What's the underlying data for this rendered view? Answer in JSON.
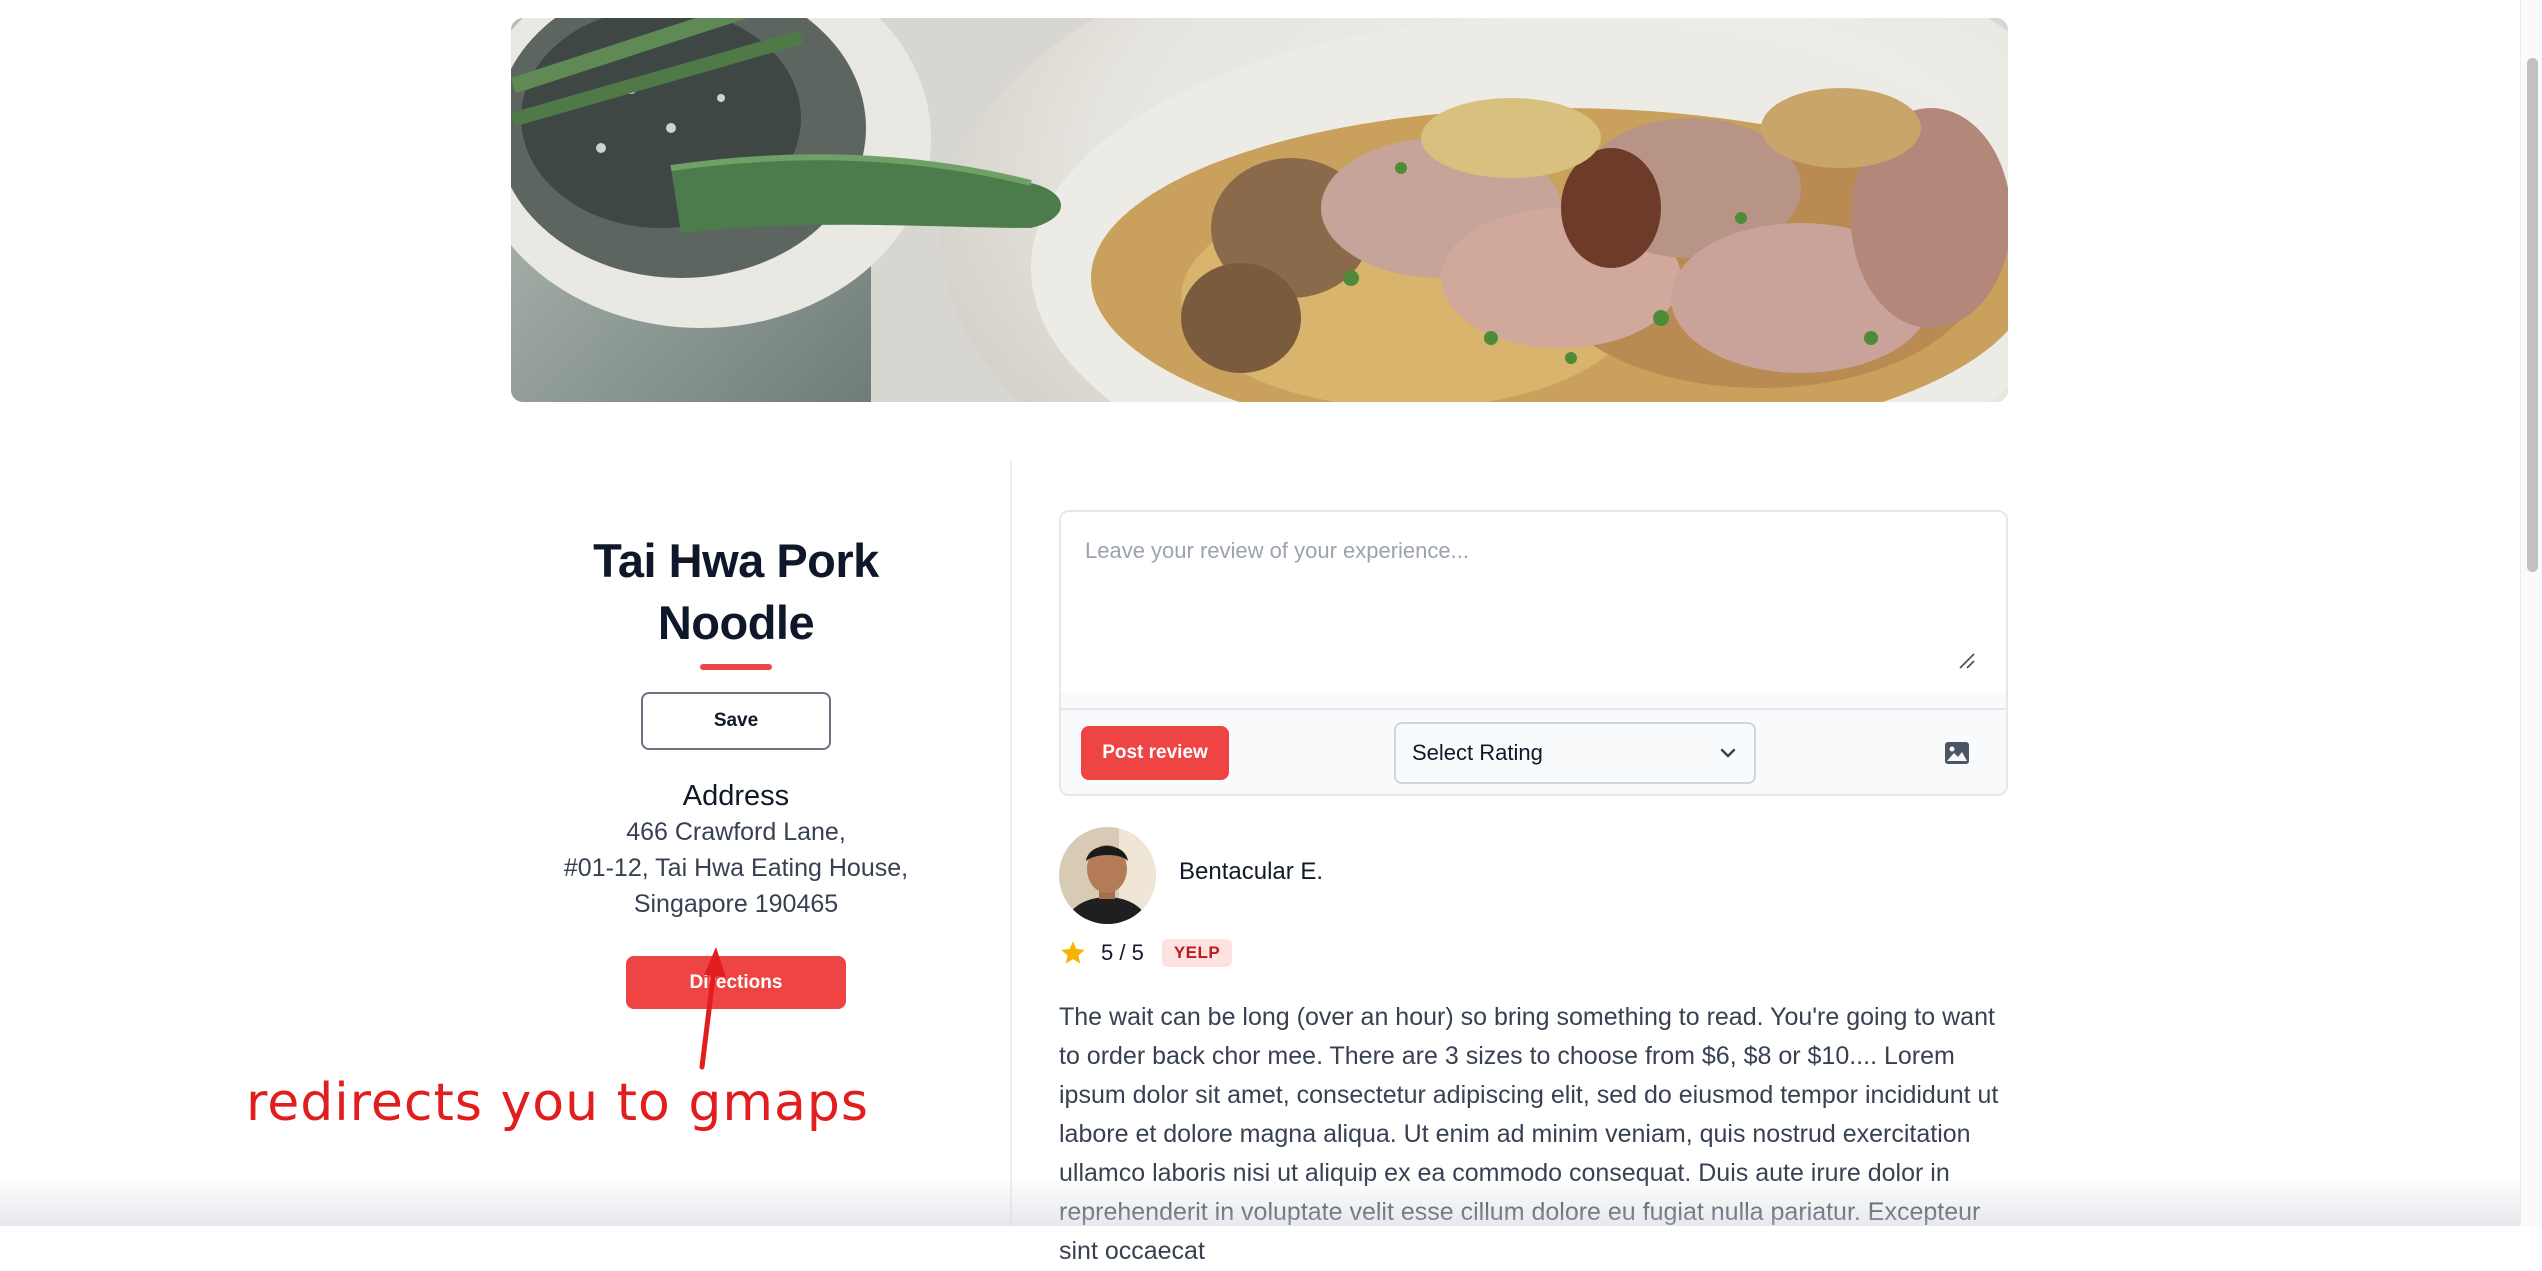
{
  "restaurant": {
    "name": "Tai Hwa Pork Noodle",
    "save_label": "Save",
    "address_heading": "Address",
    "address_lines": [
      "466 Crawford Lane,",
      "#01-12, Tai Hwa Eating House,",
      "Singapore 190465"
    ],
    "directions_label": "Directions"
  },
  "annotation": {
    "text": "redirects you to gmaps"
  },
  "composer": {
    "placeholder": "Leave your review of your experience...",
    "post_label": "Post review",
    "rating_select_label": "Select Rating"
  },
  "review": {
    "reviewer": "Bentacular E.",
    "rating": "5 / 5",
    "source": "YELP",
    "text": "The wait can be long (over an hour) so bring something to read. You're going to want to order back chor mee. There are 3 sizes to choose from $6, $8 or $10.... Lorem ipsum dolor sit amet, consectetur adipiscing elit, sed do eiusmod tempor incididunt ut labore et dolore magna aliqua. Ut enim ad minim veniam, quis nostrud exercitation ullamco laboris nisi ut aliquip ex ea commodo consequat. Duis aute irure dolor in reprehenderit in voluptate velit esse cillum dolore eu fugiat nulla pariatur. Excepteur sint occaecat"
  },
  "icons": {
    "star": "star-icon",
    "image_upload": "image-icon",
    "chevron": "chevron-down-icon",
    "resize": "resize-grip-icon"
  },
  "colors": {
    "accent": "#ef4444",
    "star": "#f5b400",
    "badge_bg": "#fee2e2",
    "badge_text": "#b91c1c",
    "annotation": "#e11d1d"
  }
}
